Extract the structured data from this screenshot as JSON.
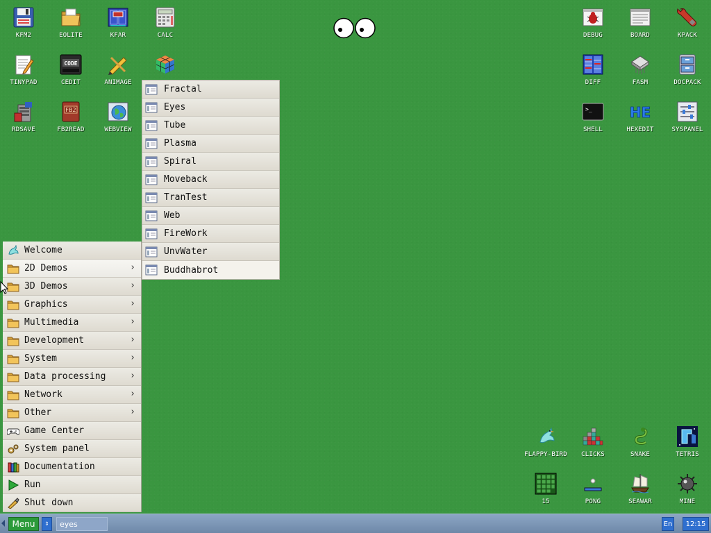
{
  "desktop": {
    "icons_left": [
      {
        "label": "KFM2",
        "icon": "floppy-icon"
      },
      {
        "label": "EOLITE",
        "icon": "folder-icon"
      },
      {
        "label": "KFAR",
        "icon": "kfar-icon"
      },
      {
        "label": "CALC",
        "icon": "calculator-icon"
      },
      {
        "label": "TINYPAD",
        "icon": "notepad-icon"
      },
      {
        "label": "CEDIT",
        "icon": "code-editor-icon"
      },
      {
        "label": "ANIMAGE",
        "icon": "pencil-icon"
      },
      {
        "label": "RDSAVE",
        "icon": "rdsave-icon"
      },
      {
        "label": "FB2READ",
        "icon": "book-icon"
      },
      {
        "label": "WEBVIEW",
        "icon": "globe-icon"
      }
    ],
    "icons_right": [
      {
        "label": "DEBUG",
        "icon": "bug-icon"
      },
      {
        "label": "BOARD",
        "icon": "board-icon"
      },
      {
        "label": "KPACK",
        "icon": "wrench-icon"
      },
      {
        "label": "DIFF",
        "icon": "diff-icon"
      },
      {
        "label": "FASM",
        "icon": "fasm-icon"
      },
      {
        "label": "DOCPACK",
        "icon": "cabinet-icon"
      },
      {
        "label": "SHELL",
        "icon": "terminal-icon"
      },
      {
        "label": "HEXEDIT",
        "icon": "hex-icon"
      },
      {
        "label": "SYSPANEL",
        "icon": "sliders-icon"
      }
    ],
    "icons_games": [
      {
        "label": "FLAPPY-BIRD",
        "icon": "bird-icon"
      },
      {
        "label": "CLICKS",
        "icon": "blocks-icon"
      },
      {
        "label": "SNAKE",
        "icon": "snake-icon"
      },
      {
        "label": "TETRIS",
        "icon": "tetris-icon"
      },
      {
        "label": "15",
        "icon": "grid-icon"
      },
      {
        "label": "PONG",
        "icon": "pong-icon"
      },
      {
        "label": "SEAWAR",
        "icon": "ship-icon"
      },
      {
        "label": "MINE",
        "icon": "mine-icon"
      }
    ]
  },
  "main_menu": {
    "items": [
      {
        "label": "Welcome",
        "icon": "bird-icon",
        "arrow": ""
      },
      {
        "label": "2D Demos",
        "icon": "folder-icon",
        "arrow": "›"
      },
      {
        "label": "3D Demos",
        "icon": "folder-icon",
        "arrow": "›"
      },
      {
        "label": "Graphics",
        "icon": "folder-icon",
        "arrow": "›"
      },
      {
        "label": "Multimedia",
        "icon": "folder-icon",
        "arrow": "›"
      },
      {
        "label": "Development",
        "icon": "folder-icon",
        "arrow": "›"
      },
      {
        "label": "System",
        "icon": "folder-icon",
        "arrow": "›"
      },
      {
        "label": "Data processing",
        "icon": "folder-icon",
        "arrow": "›"
      },
      {
        "label": "Network",
        "icon": "folder-icon",
        "arrow": "›"
      },
      {
        "label": "Other",
        "icon": "folder-icon",
        "arrow": "›"
      },
      {
        "label": "Game Center",
        "icon": "gamepad-icon",
        "arrow": ""
      },
      {
        "label": "System panel",
        "icon": "gears-icon",
        "arrow": ""
      },
      {
        "label": "Documentation",
        "icon": "books-icon",
        "arrow": ""
      },
      {
        "label": "Run",
        "icon": "play-icon",
        "arrow": ""
      },
      {
        "label": "Shut down",
        "icon": "power-icon",
        "arrow": ""
      }
    ]
  },
  "sub_menu": {
    "items": [
      "Fractal",
      "Eyes",
      "Tube",
      "Plasma",
      "Spiral",
      "Moveback",
      "TranTest",
      "Web",
      "FireWork",
      "UnvWater",
      "Buddhabrot"
    ]
  },
  "taskbar": {
    "menu_label": "Menu",
    "switch_label": "⇕",
    "task_label": "eyes",
    "lang": "En",
    "clock": "12:15"
  },
  "colors": {
    "desktop": "#3a9640",
    "taskbar": "#7c96b6",
    "accent_blue": "#2f6fcf",
    "menu_green": "#2b9a3a",
    "menu_bg": "#e9e5dc"
  }
}
